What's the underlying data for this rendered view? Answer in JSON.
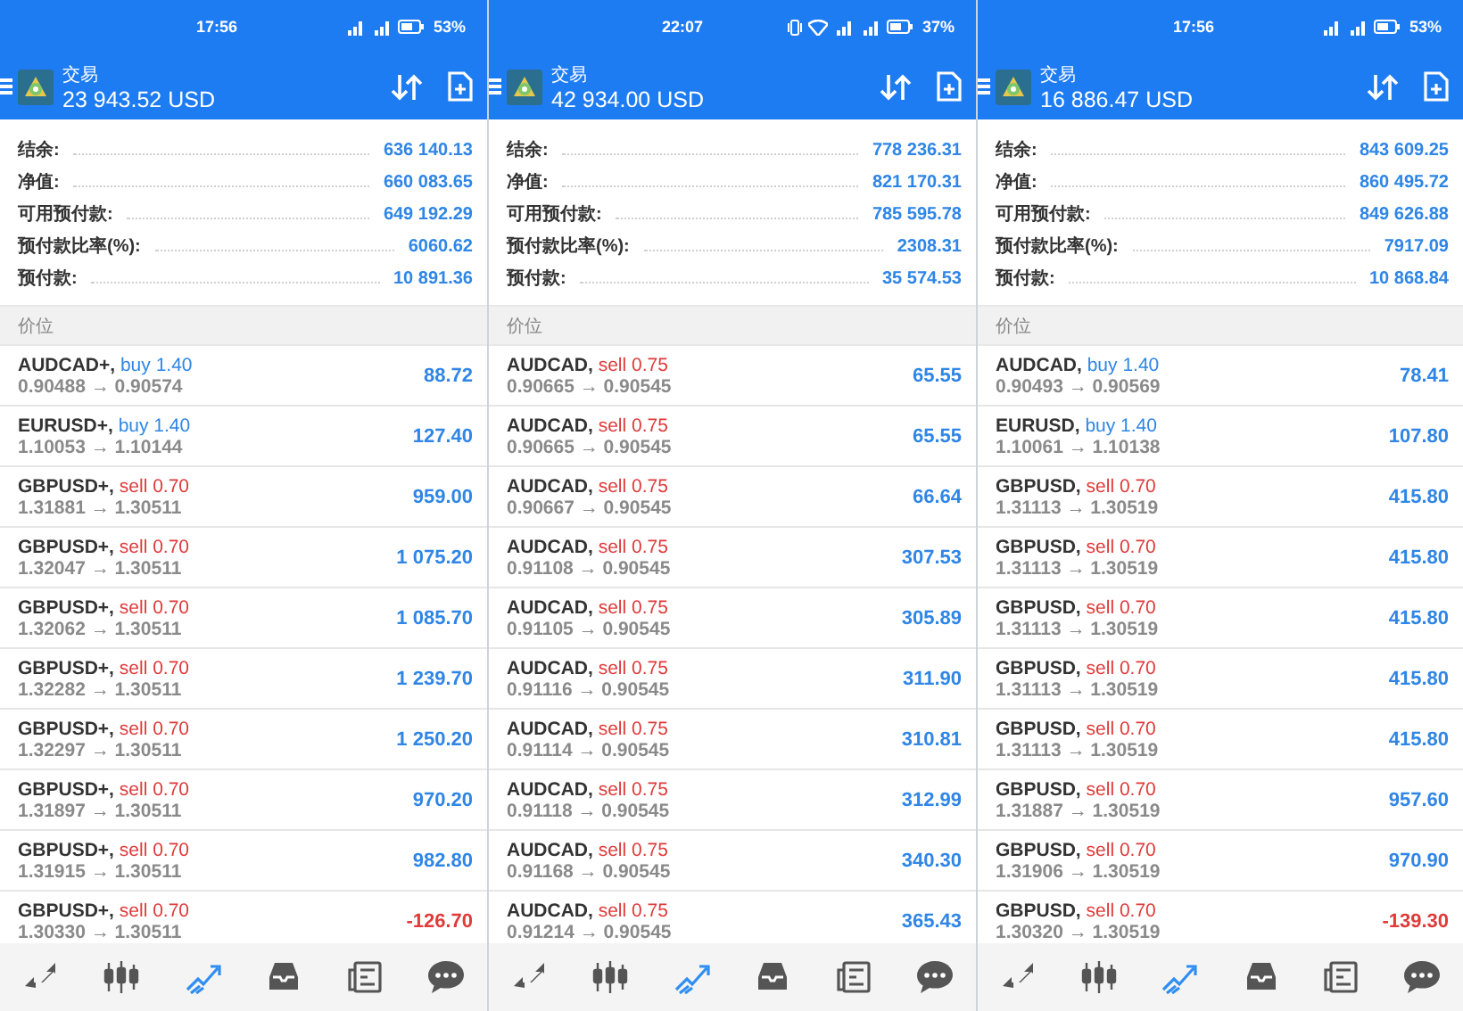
{
  "panels": [
    {
      "status_bar": {
        "time": "17:56",
        "indicators": [
          {
            "kind": "signal"
          },
          {
            "kind": "signal"
          },
          {
            "kind": "battery"
          }
        ],
        "battery": "53%"
      },
      "header": {
        "title": "交易",
        "balance": "23 943.52 USD"
      },
      "summary": [
        {
          "label": "结余:",
          "value": "636 140.13"
        },
        {
          "label": "净值:",
          "value": "660 083.65"
        },
        {
          "label": "可用预付款:",
          "value": "649 192.29"
        },
        {
          "label": "预付款比率(%):",
          "value": "6060.62"
        },
        {
          "label": "预付款:",
          "value": "10 891.36"
        }
      ],
      "section_title": "价位",
      "positions": [
        {
          "symbol": "AUDCAD+,",
          "kind": "buy",
          "order": "buy 1.40",
          "prices": "0.90488 → 0.90574",
          "profit": "88.72",
          "loss": false
        },
        {
          "symbol": "EURUSD+,",
          "kind": "buy",
          "order": "buy 1.40",
          "prices": "1.10053 → 1.10144",
          "profit": "127.40",
          "loss": false
        },
        {
          "symbol": "GBPUSD+,",
          "kind": "sell",
          "order": "sell 0.70",
          "prices": "1.31881 → 1.30511",
          "profit": "959.00",
          "loss": false
        },
        {
          "symbol": "GBPUSD+,",
          "kind": "sell",
          "order": "sell 0.70",
          "prices": "1.32047 → 1.30511",
          "profit": "1 075.20",
          "loss": false
        },
        {
          "symbol": "GBPUSD+,",
          "kind": "sell",
          "order": "sell 0.70",
          "prices": "1.32062 → 1.30511",
          "profit": "1 085.70",
          "loss": false
        },
        {
          "symbol": "GBPUSD+,",
          "kind": "sell",
          "order": "sell 0.70",
          "prices": "1.32282 → 1.30511",
          "profit": "1 239.70",
          "loss": false
        },
        {
          "symbol": "GBPUSD+,",
          "kind": "sell",
          "order": "sell 0.70",
          "prices": "1.32297 → 1.30511",
          "profit": "1 250.20",
          "loss": false
        },
        {
          "symbol": "GBPUSD+,",
          "kind": "sell",
          "order": "sell 0.70",
          "prices": "1.31897 → 1.30511",
          "profit": "970.20",
          "loss": false
        },
        {
          "symbol": "GBPUSD+,",
          "kind": "sell",
          "order": "sell 0.70",
          "prices": "1.31915 → 1.30511",
          "profit": "982.80",
          "loss": false
        },
        {
          "symbol": "GBPUSD+,",
          "kind": "sell",
          "order": "sell 0.70",
          "prices": "1.30330 → 1.30511",
          "profit": "-126.70",
          "loss": true
        }
      ],
      "nav": [
        {
          "kind": "quotes",
          "selected": false
        },
        {
          "kind": "chart",
          "selected": false
        },
        {
          "kind": "trade",
          "selected": true
        },
        {
          "kind": "history",
          "selected": false
        },
        {
          "kind": "news",
          "selected": false
        },
        {
          "kind": "chat",
          "selected": false
        }
      ]
    },
    {
      "status_bar": {
        "time": "22:07",
        "indicators": [
          {
            "kind": "vibrate"
          },
          {
            "kind": "wifi"
          },
          {
            "kind": "signal"
          },
          {
            "kind": "signal"
          },
          {
            "kind": "battery"
          }
        ],
        "battery": "37%"
      },
      "header": {
        "title": "交易",
        "balance": "42 934.00 USD"
      },
      "summary": [
        {
          "label": "结余:",
          "value": "778 236.31"
        },
        {
          "label": "净值:",
          "value": "821 170.31"
        },
        {
          "label": "可用预付款:",
          "value": "785 595.78"
        },
        {
          "label": "预付款比率(%):",
          "value": "2308.31"
        },
        {
          "label": "预付款:",
          "value": "35 574.53"
        }
      ],
      "section_title": "价位",
      "positions": [
        {
          "symbol": "AUDCAD,",
          "kind": "sell",
          "order": "sell 0.75",
          "prices": "0.90665 → 0.90545",
          "profit": "65.55",
          "loss": false
        },
        {
          "symbol": "AUDCAD,",
          "kind": "sell",
          "order": "sell 0.75",
          "prices": "0.90665 → 0.90545",
          "profit": "65.55",
          "loss": false
        },
        {
          "symbol": "AUDCAD,",
          "kind": "sell",
          "order": "sell 0.75",
          "prices": "0.90667 → 0.90545",
          "profit": "66.64",
          "loss": false
        },
        {
          "symbol": "AUDCAD,",
          "kind": "sell",
          "order": "sell 0.75",
          "prices": "0.91108 → 0.90545",
          "profit": "307.53",
          "loss": false
        },
        {
          "symbol": "AUDCAD,",
          "kind": "sell",
          "order": "sell 0.75",
          "prices": "0.91105 → 0.90545",
          "profit": "305.89",
          "loss": false
        },
        {
          "symbol": "AUDCAD,",
          "kind": "sell",
          "order": "sell 0.75",
          "prices": "0.91116 → 0.90545",
          "profit": "311.90",
          "loss": false
        },
        {
          "symbol": "AUDCAD,",
          "kind": "sell",
          "order": "sell 0.75",
          "prices": "0.91114 → 0.90545",
          "profit": "310.81",
          "loss": false
        },
        {
          "symbol": "AUDCAD,",
          "kind": "sell",
          "order": "sell 0.75",
          "prices": "0.91118 → 0.90545",
          "profit": "312.99",
          "loss": false
        },
        {
          "symbol": "AUDCAD,",
          "kind": "sell",
          "order": "sell 0.75",
          "prices": "0.91168 → 0.90545",
          "profit": "340.30",
          "loss": false
        },
        {
          "symbol": "AUDCAD,",
          "kind": "sell",
          "order": "sell 0.75",
          "prices": "0.91214 → 0.90545",
          "profit": "365.43",
          "loss": false
        }
      ],
      "nav": [
        {
          "kind": "quotes",
          "selected": false
        },
        {
          "kind": "chart",
          "selected": false
        },
        {
          "kind": "trade",
          "selected": true
        },
        {
          "kind": "history",
          "selected": false
        },
        {
          "kind": "news",
          "selected": false
        },
        {
          "kind": "chat",
          "selected": false
        }
      ]
    },
    {
      "status_bar": {
        "time": "17:56",
        "indicators": [
          {
            "kind": "signal"
          },
          {
            "kind": "signal"
          },
          {
            "kind": "battery"
          }
        ],
        "battery": "53%"
      },
      "header": {
        "title": "交易",
        "balance": "16 886.47 USD"
      },
      "summary": [
        {
          "label": "结余:",
          "value": "843 609.25"
        },
        {
          "label": "净值:",
          "value": "860 495.72"
        },
        {
          "label": "可用预付款:",
          "value": "849 626.88"
        },
        {
          "label": "预付款比率(%):",
          "value": "7917.09"
        },
        {
          "label": "预付款:",
          "value": "10 868.84"
        }
      ],
      "section_title": "价位",
      "positions": [
        {
          "symbol": "AUDCAD,",
          "kind": "buy",
          "order": "buy 1.40",
          "prices": "0.90493 → 0.90569",
          "profit": "78.41",
          "loss": false
        },
        {
          "symbol": "EURUSD,",
          "kind": "buy",
          "order": "buy 1.40",
          "prices": "1.10061 → 1.10138",
          "profit": "107.80",
          "loss": false
        },
        {
          "symbol": "GBPUSD,",
          "kind": "sell",
          "order": "sell 0.70",
          "prices": "1.31113 → 1.30519",
          "profit": "415.80",
          "loss": false
        },
        {
          "symbol": "GBPUSD,",
          "kind": "sell",
          "order": "sell 0.70",
          "prices": "1.31113 → 1.30519",
          "profit": "415.80",
          "loss": false
        },
        {
          "symbol": "GBPUSD,",
          "kind": "sell",
          "order": "sell 0.70",
          "prices": "1.31113 → 1.30519",
          "profit": "415.80",
          "loss": false
        },
        {
          "symbol": "GBPUSD,",
          "kind": "sell",
          "order": "sell 0.70",
          "prices": "1.31113 → 1.30519",
          "profit": "415.80",
          "loss": false
        },
        {
          "symbol": "GBPUSD,",
          "kind": "sell",
          "order": "sell 0.70",
          "prices": "1.31113 → 1.30519",
          "profit": "415.80",
          "loss": false
        },
        {
          "symbol": "GBPUSD,",
          "kind": "sell",
          "order": "sell 0.70",
          "prices": "1.31887 → 1.30519",
          "profit": "957.60",
          "loss": false
        },
        {
          "symbol": "GBPUSD,",
          "kind": "sell",
          "order": "sell 0.70",
          "prices": "1.31906 → 1.30519",
          "profit": "970.90",
          "loss": false
        },
        {
          "symbol": "GBPUSD,",
          "kind": "sell",
          "order": "sell 0.70",
          "prices": "1.30320 → 1.30519",
          "profit": "-139.30",
          "loss": true
        }
      ],
      "nav": [
        {
          "kind": "quotes",
          "selected": false
        },
        {
          "kind": "chart",
          "selected": false
        },
        {
          "kind": "trade",
          "selected": true
        },
        {
          "kind": "history",
          "selected": false
        },
        {
          "kind": "news",
          "selected": false
        },
        {
          "kind": "chat",
          "selected": false
        }
      ]
    }
  ]
}
